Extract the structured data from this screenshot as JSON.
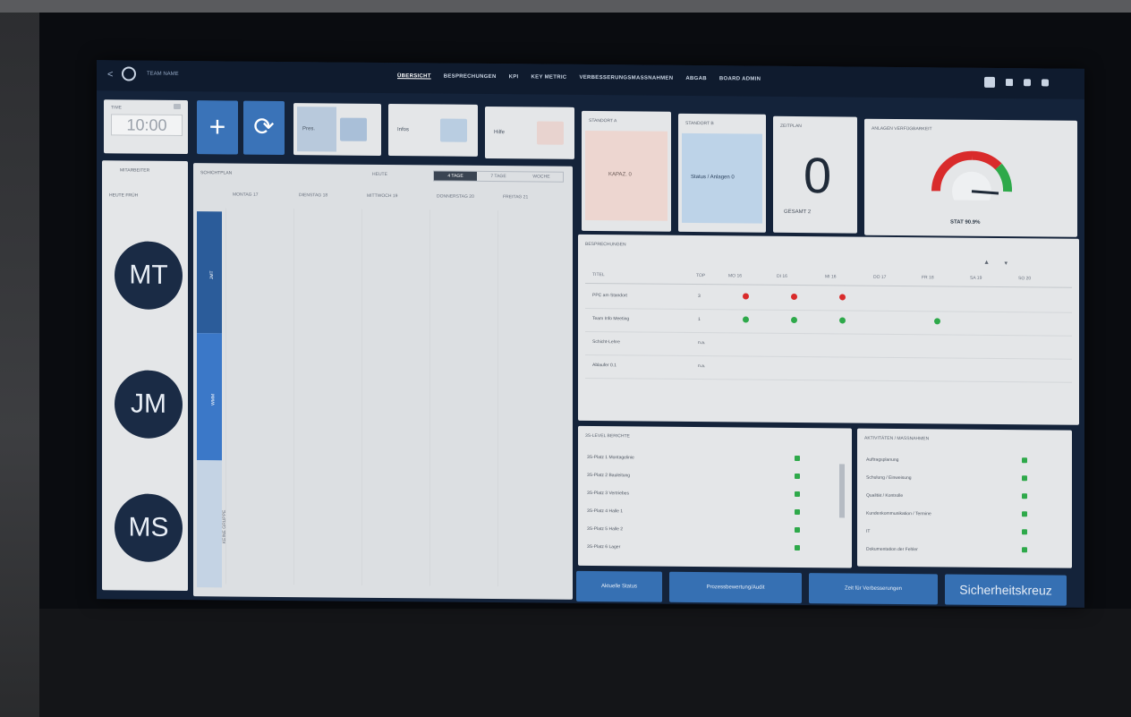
{
  "header": {
    "back": "<",
    "team": "TEAM NAME",
    "nav": [
      "ÜBERSICHT",
      "BESPRECHUNGEN",
      "KPI",
      "KEY METRIC",
      "VERBESSERUNGSMASSNAHMEN",
      "ABGAB",
      "BOARD ADMIN"
    ]
  },
  "toolbar": {
    "time_label": "TIME",
    "time_value": "10:00",
    "plus": "+",
    "refresh": "⟳",
    "btn1": "Pres.",
    "btn2": "Infos",
    "btn3": "Hilfe"
  },
  "status": {
    "card1_title": "STANDORT A",
    "card1_value": "KAPAZ. 0",
    "card2_title": "STANDORT B",
    "card2_value": "Status / Anlagen 0",
    "card3_title": "ZEITPLAN",
    "card3_value": "0",
    "card3_sub": "GESAMT 2",
    "gauge_title": "ANLAGEN VERFÜGBARKEIT",
    "gauge_sub": "STAT 90.9%"
  },
  "people": {
    "title": "MITARBEITER",
    "sub": "HEUTE FRÜH",
    "avatars": [
      "MT",
      "JM",
      "MS"
    ]
  },
  "calendar": {
    "title": "SCHICHTPLAN",
    "filter": "HEUTE",
    "views": [
      "4 TAGE",
      "7 TAGE",
      "WOCHE"
    ],
    "days": [
      "MONTAG 17",
      "DIENSTAG 18",
      "MITTWOCH 19",
      "DONNERSTAG 20",
      "FREITAG 21"
    ],
    "lanes": [
      "JMT",
      "WMM",
      "KEINE GRUPPE"
    ]
  },
  "matrix": {
    "title": "BESPRECHUNGEN",
    "cols": [
      "TITEL",
      "TOP",
      "MO 16",
      "DI 16",
      "MI 16",
      "DO 17",
      "FR 18",
      "SA 19",
      "SO 20"
    ],
    "rows": [
      {
        "name": "PPC am Standort",
        "num": "3"
      },
      {
        "name": "Team Info Meeting",
        "num": "1"
      },
      {
        "name": "Schicht-Lehre",
        "num": "n.a."
      },
      {
        "name": "Ablaufer 0.1",
        "num": "n.a."
      }
    ]
  },
  "checklist1": {
    "title": "3S-LEVEL BERICHTE",
    "items": [
      "3S-Platz 1 Montagelinie",
      "3S-Platz 2 Bauleitung",
      "3S-Platz 3 Vertriebes",
      "3S-Platz 4 Halle 1",
      "3S-Platz 5 Halle 2",
      "3S-Platz 6 Lager"
    ]
  },
  "checklist2": {
    "title": "AKTIVITÄTEN / MASSNAHMEN",
    "items": [
      "Auftragsplanung",
      "Schulung / Einweisung",
      "Qualität / Kontrolle",
      "Kundenkommunikation / Termine",
      "IT",
      "Dokumentation der Fehler"
    ]
  },
  "actions": [
    "Aktuelle Status",
    "Prozessbewertung/Audit",
    "Zeit für Verbesserungen",
    "Sicherheitskreuz"
  ],
  "colors": {
    "accent": "#3a73b8",
    "red": "#d92b2b",
    "green": "#2ea94a",
    "navy": "#1a2b45"
  }
}
